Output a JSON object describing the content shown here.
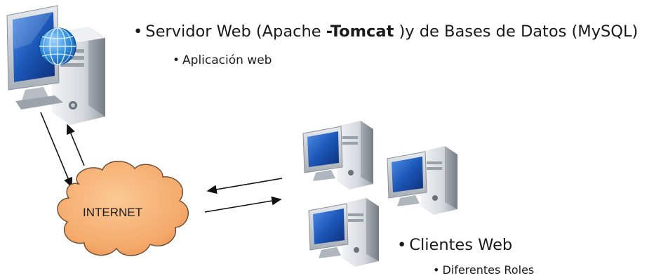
{
  "server": {
    "bullet": "•",
    "title_pre": "Servidor Web (Apache ",
    "title_bold": "-Tomcat",
    "title_post": " )y de Bases de Datos (MySQL)",
    "sub_bullet": "•",
    "subtitle": "Aplicación web"
  },
  "internet": {
    "label": "INTERNET"
  },
  "clients": {
    "bullet": "•",
    "title": "Clientes Web",
    "sub_bullet": "•",
    "subtitle": "Diferentes Roles"
  },
  "colors": {
    "cloud_fill": "#f4a96a",
    "screen_blue": "#1c57b8",
    "case_gray": "#cfd3d8",
    "globe_blue": "#2f8ee0"
  }
}
